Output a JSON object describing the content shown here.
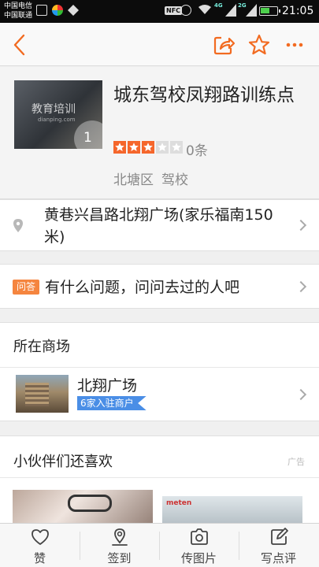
{
  "status_bar": {
    "carrier_1": "中国电信",
    "carrier_2": "中国联通",
    "nfc": "NFC",
    "net_1": "4G",
    "net_2": "2G",
    "time": "21:05",
    "battery_level": 0.6
  },
  "nav": {
    "back_icon": "chevron-left-icon",
    "share_icon": "share-icon",
    "favorite_icon": "star-outline-icon",
    "more_icon": "more-dots-icon",
    "accent_color": "#f26b21"
  },
  "shop": {
    "title": "城东驾校凤翔路训练点",
    "thumb_watermark": "教育培训",
    "thumb_watermark_sub": "dianping.com",
    "photo_count": "1",
    "rating": 3,
    "rating_max": 5,
    "review_count": "0条",
    "district": "北塘区",
    "category": "驾校"
  },
  "address": {
    "icon": "location-pin-icon",
    "text": "黄巷兴昌路北翔广场(家乐福南150米)"
  },
  "qa": {
    "tag": "问答",
    "text": "有什么问题，问问去过的人吧"
  },
  "mall": {
    "heading": "所在商场",
    "name": "北翔广场",
    "badge": "6家入驻商户"
  },
  "recommendations": {
    "heading": "小伙伴们还喜欢",
    "ad_label": "广告",
    "item_2_brand": "meten"
  },
  "tabbar": {
    "items": [
      {
        "label": "赞",
        "icon": "heart-icon"
      },
      {
        "label": "签到",
        "icon": "location-checkin-icon"
      },
      {
        "label": "传图片",
        "icon": "camera-icon"
      },
      {
        "label": "写点评",
        "icon": "edit-icon"
      }
    ]
  }
}
